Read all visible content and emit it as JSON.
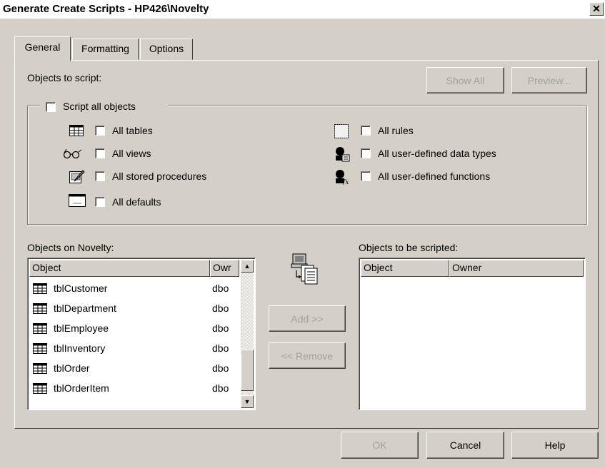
{
  "window": {
    "title": "Generate Create Scripts - HP426\\Novelty",
    "close_glyph": "✕"
  },
  "tabs": [
    {
      "label": "General",
      "active": true
    },
    {
      "label": "Formatting",
      "active": false
    },
    {
      "label": "Options",
      "active": false
    }
  ],
  "objects_to_script": {
    "label": "Objects to script:",
    "show_all_label": "Show All",
    "preview_label": "Preview...",
    "script_all_label": "Script all objects",
    "options": {
      "all_tables": "All tables",
      "all_views": "All views",
      "all_stored_procedures": "All stored procedures",
      "all_defaults": "All defaults",
      "all_rules": "All rules",
      "all_user_defined_data_types": "All user-defined data types",
      "all_user_defined_functions": "All user-defined functions"
    }
  },
  "source_list": {
    "label": "Objects on Novelty:",
    "columns": {
      "object": "Object",
      "owner": "Owr"
    },
    "rows": [
      {
        "name": "tblCustomer",
        "owner": "dbo"
      },
      {
        "name": "tblDepartment",
        "owner": "dbo"
      },
      {
        "name": "tblEmployee",
        "owner": "dbo"
      },
      {
        "name": "tblInventory",
        "owner": "dbo"
      },
      {
        "name": "tblOrder",
        "owner": "dbo"
      },
      {
        "name": "tblOrderItem",
        "owner": "dbo"
      }
    ]
  },
  "transfer": {
    "add_label": "Add >>",
    "remove_label": "<< Remove"
  },
  "target_list": {
    "label": "Objects to be scripted:",
    "columns": {
      "object": "Object",
      "owner": "Owner"
    }
  },
  "footer": {
    "ok_label": "OK",
    "cancel_label": "Cancel",
    "help_label": "Help"
  }
}
